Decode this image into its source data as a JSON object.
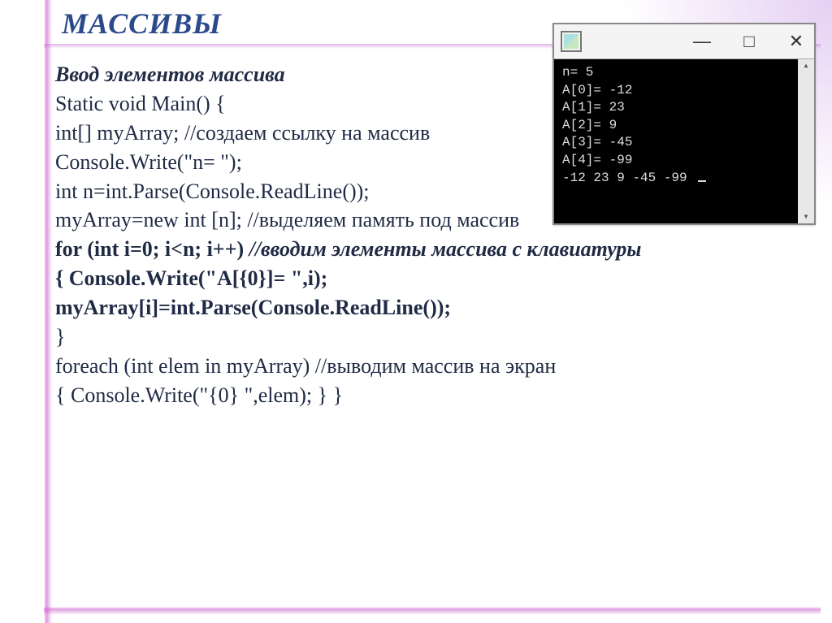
{
  "title": "МАССИВЫ",
  "subtitle": "Ввод элементов массива",
  "code": {
    "l1": "Static void Main() {",
    "l2a": " int[] myArray;  //",
    "l2b": "создаем ссылку на массив",
    "l3": "Console.Write(\"n= \");",
    "l4": "int n=int.Parse(Console.ReadLine());",
    "l5": "myArray=new int [n];  //выделяем память под массив",
    "l6a": "for (int i=0; i<n; i++)  ",
    "l6b": "//вводим элементы массива с клавиатуры",
    "l7": "{   Console.Write(\"A[{0}]= \",i);",
    "l8": "myArray[i]=int.Parse(Console.ReadLine());",
    "l9": " }",
    "l10": "foreach (int elem in myArray) //выводим массив на экран",
    "l11": " {   Console.Write(\"{0} \",elem);  } }"
  },
  "console": {
    "lines": [
      "n= 5",
      "A[0]= -12",
      "A[1]= 23",
      "A[2]= 9",
      "A[3]= -45",
      "A[4]= -99",
      "-12 23 9 -45 -99 "
    ],
    "titlebar": {
      "minimize": "—",
      "maximize": "□",
      "close": "✕"
    }
  }
}
